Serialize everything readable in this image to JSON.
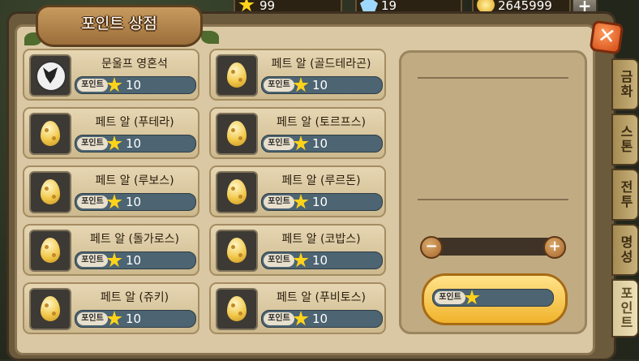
{
  "title": "포인트 상점",
  "currencies": [
    {
      "icon": "star-icon",
      "value": "99"
    },
    {
      "icon": "crystal-icon",
      "value": "19"
    },
    {
      "icon": "gold-coin-icon",
      "value": "2645999"
    }
  ],
  "point_label": "포인트",
  "items": [
    {
      "name": "문울프 영혼석",
      "price": "10",
      "icon": "wolf-soulstone-icon"
    },
    {
      "name": "페트 알 (골드테라곤)",
      "price": "10",
      "icon": "egg-icon"
    },
    {
      "name": "페트 알 (푸테라)",
      "price": "10",
      "icon": "egg-icon"
    },
    {
      "name": "페트 알 (토르프스)",
      "price": "10",
      "icon": "egg-icon"
    },
    {
      "name": "페트 알 (루보스)",
      "price": "10",
      "icon": "egg-icon"
    },
    {
      "name": "페트 알 (루르돈)",
      "price": "10",
      "icon": "egg-icon"
    },
    {
      "name": "페트 알 (돌가로스)",
      "price": "10",
      "icon": "egg-icon"
    },
    {
      "name": "페트 알 (코밥스)",
      "price": "10",
      "icon": "egg-icon"
    },
    {
      "name": "페트 알 (쥬키)",
      "price": "10",
      "icon": "egg-icon"
    },
    {
      "name": "페트 알 (푸비토스)",
      "price": "10",
      "icon": "egg-icon"
    }
  ],
  "buy_button": {
    "label": "포인트",
    "value": ""
  },
  "tabs": [
    "금화",
    "스톤",
    "전투",
    "명성",
    "포인트"
  ],
  "active_tab": "포인트"
}
